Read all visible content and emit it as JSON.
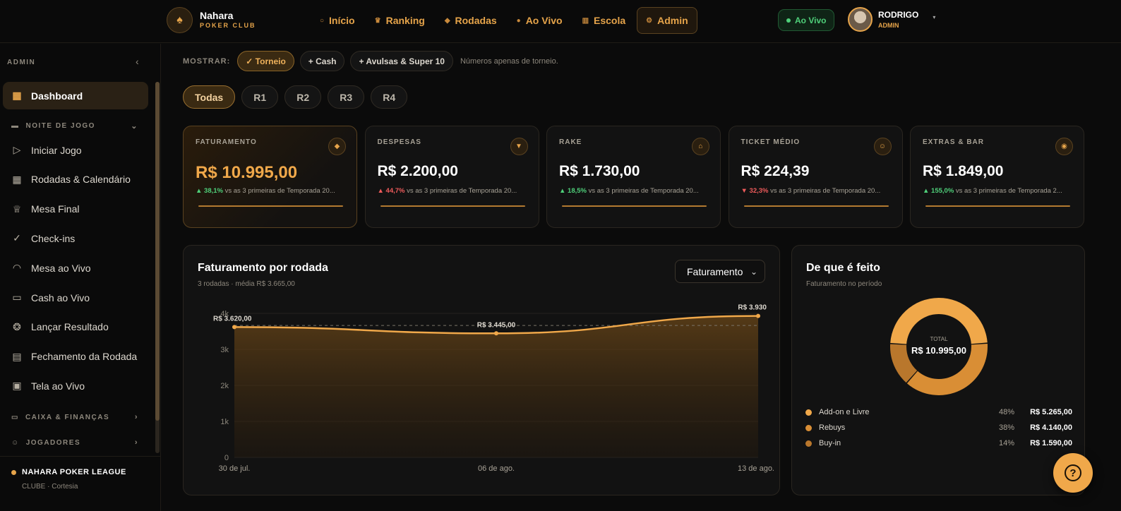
{
  "brand": {
    "name": "Nahara",
    "sub": "POKER CLUB"
  },
  "nav": [
    {
      "label": "Início",
      "icon": "home-icon",
      "glyph": "○"
    },
    {
      "label": "Ranking",
      "icon": "crown-icon",
      "glyph": "♛"
    },
    {
      "label": "Rodadas",
      "icon": "diamond-icon",
      "glyph": "◆"
    },
    {
      "label": "Ao Vivo",
      "icon": "live-dot-icon",
      "glyph": "●"
    },
    {
      "label": "Escola",
      "icon": "books-icon",
      "glyph": "▥"
    },
    {
      "label": "Admin",
      "icon": "gear-icon",
      "glyph": "⚙"
    }
  ],
  "live_badge": "Ao Vivo",
  "user": {
    "name": "RODRIGO",
    "role": "ADMIN"
  },
  "sidebar": {
    "header": "ADMIN",
    "dashboard": "Dashboard",
    "group_night": "NOITE DE JOGO",
    "items": [
      {
        "label": "Iniciar Jogo",
        "icon": "play-icon",
        "glyph": "▷"
      },
      {
        "label": "Rodadas & Calendário",
        "icon": "calendar-icon",
        "glyph": "▦"
      },
      {
        "label": "Mesa Final",
        "icon": "trophy-icon",
        "glyph": "♕"
      },
      {
        "label": "Check-ins",
        "icon": "check-circle-icon",
        "glyph": "✓"
      },
      {
        "label": "Mesa ao Vivo",
        "icon": "gauge-icon",
        "glyph": "◠"
      },
      {
        "label": "Cash ao Vivo",
        "icon": "cash-icon",
        "glyph": "▭"
      },
      {
        "label": "Lançar Resultado",
        "icon": "medal-icon",
        "glyph": "❂"
      },
      {
        "label": "Fechamento da Rodada",
        "icon": "clipboard-icon",
        "glyph": "▤"
      },
      {
        "label": "Tela ao Vivo",
        "icon": "monitor-icon",
        "glyph": "▣"
      }
    ],
    "group_finance": "CAIXA & FINANÇAS",
    "group_players": "JOGADORES",
    "footer_title": "NAHARA POKER LEAGUE",
    "footer_sub": "CLUBE · Cortesia"
  },
  "filters": {
    "label": "MOSTRAR:",
    "chips": [
      "✓ Torneio",
      "+ Cash",
      "+ Avulsas & Super 10"
    ],
    "note": "Números apenas de torneio."
  },
  "rounds": [
    "Todas",
    "R1",
    "R2",
    "R3",
    "R4"
  ],
  "kpis": [
    {
      "label": "FATURAMENTO",
      "value": "R$ 10.995,00",
      "delta": "38,1%",
      "dir": "up",
      "note": "vs as 3 primeiras de Temporada 20...",
      "icon": "diamond-icon",
      "glyph": "◆"
    },
    {
      "label": "DESPESAS",
      "value": "R$ 2.200,00",
      "delta": "44,7%",
      "dir": "up-bad",
      "note": "vs as 3 primeiras de Temporada 20...",
      "icon": "arrow-down-icon",
      "glyph": "▼"
    },
    {
      "label": "RAKE",
      "value": "R$ 1.730,00",
      "delta": "18,5%",
      "dir": "up",
      "note": "vs as 3 primeiras de Temporada 20...",
      "icon": "house-icon",
      "glyph": "⌂"
    },
    {
      "label": "TICKET MÉDIO",
      "value": "R$ 224,39",
      "delta": "32,3%",
      "dir": "down",
      "note": "vs as 3 primeiras de Temporada 20...",
      "icon": "smile-icon",
      "glyph": "☺"
    },
    {
      "label": "EXTRAS & BAR",
      "value": "R$ 1.849,00",
      "delta": "155,0%",
      "dir": "up",
      "note": "vs as 3 primeiras de Temporada 2...",
      "icon": "cup-icon",
      "glyph": "◉"
    }
  ],
  "revenue_card": {
    "title": "Faturamento por rodada",
    "subtitle": "3 rodadas · média R$ 3.665,00",
    "select": "Faturamento"
  },
  "composition_card": {
    "title": "De que é feito",
    "subtitle": "Faturamento no período",
    "center_label": "TOTAL",
    "center_value": "R$ 10.995,00",
    "legend": [
      {
        "label": "Add-on e Livre",
        "pct": "48%",
        "value": "R$ 5.265,00",
        "color": "#f0a84a"
      },
      {
        "label": "Rebuys",
        "pct": "38%",
        "value": "R$ 4.140,00",
        "color": "#d98e35"
      },
      {
        "label": "Buy-in",
        "pct": "14%",
        "value": "R$ 1.590,00",
        "color": "#b9772c"
      }
    ]
  },
  "chart_data": [
    {
      "type": "area",
      "x": [
        "30 de jul.",
        "06 de ago.",
        "13 de ago."
      ],
      "series": [
        {
          "values": [
            3620,
            3445,
            3930
          ]
        }
      ],
      "data_labels": [
        "R$ 3.620,00",
        "R$ 3.445,00",
        "R$ 3.930"
      ],
      "reference_line": 3665,
      "y_ticks": [
        "0",
        "1k",
        "2k",
        "3k",
        "4k"
      ],
      "ylim": [
        0,
        4000
      ],
      "grid": true,
      "color": "#f0a84a"
    },
    {
      "type": "pie",
      "donut": true,
      "categories": [
        "Add-on e Livre",
        "Rebuys",
        "Buy-in"
      ],
      "values": [
        5265,
        4140,
        1590
      ],
      "colors": [
        "#f0a84a",
        "#d98e35",
        "#b9772c"
      ]
    }
  ]
}
